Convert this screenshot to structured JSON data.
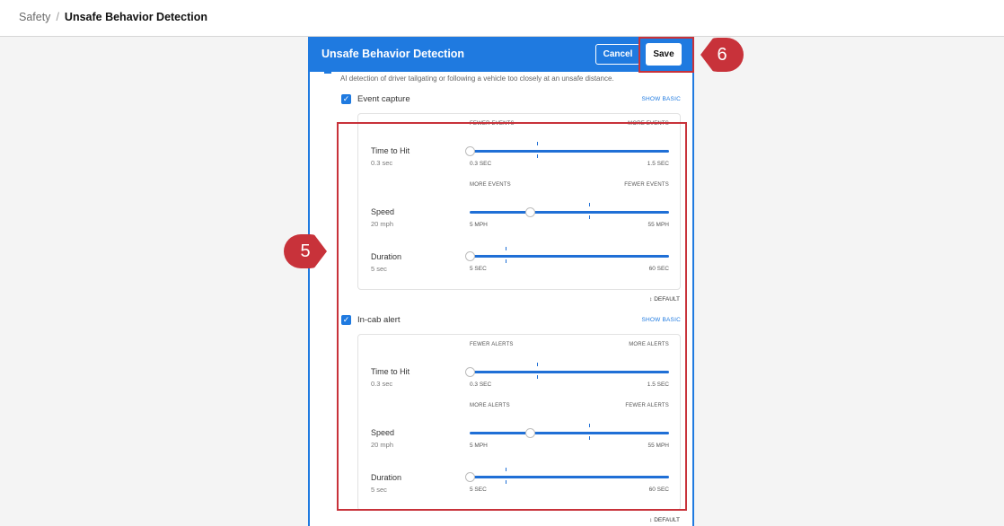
{
  "breadcrumb": {
    "root": "Safety",
    "separator": "/",
    "current": "Unsafe Behavior Detection"
  },
  "modal": {
    "title": "Unsafe Behavior Detection",
    "cancel_label": "Cancel",
    "save_label": "Save",
    "description": "AI detection of driver tailgating or following a vehicle too closely at an unsafe distance."
  },
  "event_capture": {
    "label": "Event capture",
    "checked": true,
    "show_basic": "SHOW BASIC",
    "default_label": "DEFAULT",
    "rows": [
      {
        "label": "Time to Hit",
        "value": "0.3 sec",
        "scale_left": "FEWER EVENTS",
        "scale_right": "MORE EVENTS",
        "min": "0.3 SEC",
        "max": "1.5 SEC",
        "position": 0.0,
        "default_mark": 0.34
      },
      {
        "label": "Speed",
        "value": "20 mph",
        "scale_left": "MORE EVENTS",
        "scale_right": "FEWER EVENTS",
        "min": "5 MPH",
        "max": "55 MPH",
        "position": 0.3,
        "default_mark": 0.6
      },
      {
        "label": "Duration",
        "value": "5 sec",
        "scale_left": "",
        "scale_right": "",
        "min": "5 SEC",
        "max": "60 SEC",
        "position": 0.0,
        "default_mark": 0.18
      }
    ]
  },
  "in_cab_alert": {
    "label": "In-cab alert",
    "checked": true,
    "show_basic": "SHOW BASIC",
    "default_label": "DEFAULT",
    "rows": [
      {
        "label": "Time to Hit",
        "value": "0.3 sec",
        "scale_left": "FEWER ALERTS",
        "scale_right": "MORE ALERTS",
        "min": "0.3 SEC",
        "max": "1.5 SEC",
        "position": 0.0,
        "default_mark": 0.34
      },
      {
        "label": "Speed",
        "value": "20 mph",
        "scale_left": "MORE ALERTS",
        "scale_right": "FEWER ALERTS",
        "min": "5 MPH",
        "max": "55 MPH",
        "position": 0.3,
        "default_mark": 0.6
      },
      {
        "label": "Duration",
        "value": "5 sec",
        "scale_left": "",
        "scale_right": "",
        "min": "5 SEC",
        "max": "60 SEC",
        "position": 0.0,
        "default_mark": 0.18
      }
    ]
  },
  "callouts": {
    "step_5": "5",
    "step_6": "6"
  },
  "colors": {
    "accent": "#1f7ae0",
    "callout": "#c8323a"
  }
}
